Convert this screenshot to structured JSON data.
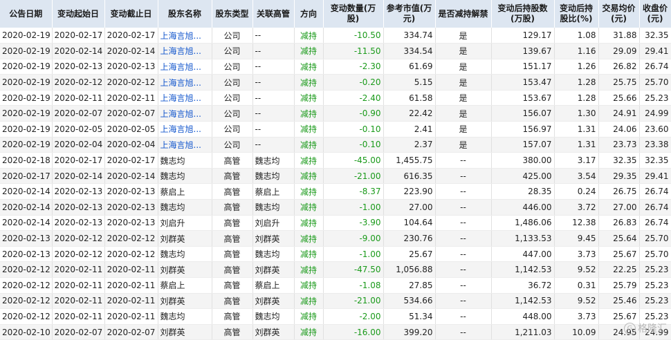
{
  "table": {
    "headers": [
      "公告日期",
      "变动起始日",
      "变动截止日",
      "股东名称",
      "股东类型",
      "关联高管",
      "方向",
      "变动数量(万股)",
      "参考市值(万元)",
      "是否减持解禁",
      "变动后持股数(万股)",
      "变动后持股比(%)",
      "交易均价(元)",
      "收盘价(元)"
    ],
    "rows": [
      [
        "2020-02-19",
        "2020-02-17",
        "2020-02-17",
        "上海言旭...",
        "公司",
        "--",
        "减持",
        "-10.50",
        "334.74",
        "是",
        "129.17",
        "1.08",
        "31.88",
        "32.35"
      ],
      [
        "2020-02-19",
        "2020-02-14",
        "2020-02-14",
        "上海言旭...",
        "公司",
        "--",
        "减持",
        "-11.50",
        "334.54",
        "是",
        "139.67",
        "1.16",
        "29.09",
        "29.41"
      ],
      [
        "2020-02-19",
        "2020-02-13",
        "2020-02-13",
        "上海言旭...",
        "公司",
        "--",
        "减持",
        "-2.30",
        "61.69",
        "是",
        "151.17",
        "1.26",
        "26.82",
        "26.74"
      ],
      [
        "2020-02-19",
        "2020-02-12",
        "2020-02-12",
        "上海言旭...",
        "公司",
        "--",
        "减持",
        "-0.20",
        "5.15",
        "是",
        "153.47",
        "1.28",
        "25.75",
        "25.70"
      ],
      [
        "2020-02-19",
        "2020-02-11",
        "2020-02-11",
        "上海言旭...",
        "公司",
        "--",
        "减持",
        "-2.40",
        "61.58",
        "是",
        "153.67",
        "1.28",
        "25.66",
        "25.23"
      ],
      [
        "2020-02-19",
        "2020-02-07",
        "2020-02-07",
        "上海言旭...",
        "公司",
        "--",
        "减持",
        "-0.90",
        "22.42",
        "是",
        "156.07",
        "1.30",
        "24.91",
        "24.99"
      ],
      [
        "2020-02-19",
        "2020-02-05",
        "2020-02-05",
        "上海言旭...",
        "公司",
        "--",
        "减持",
        "-0.10",
        "2.41",
        "是",
        "156.97",
        "1.31",
        "24.06",
        "23.60"
      ],
      [
        "2020-02-19",
        "2020-02-04",
        "2020-02-04",
        "上海言旭...",
        "公司",
        "--",
        "减持",
        "-0.10",
        "2.37",
        "是",
        "157.07",
        "1.31",
        "23.73",
        "23.38"
      ],
      [
        "2020-02-18",
        "2020-02-17",
        "2020-02-17",
        "魏志均",
        "高管",
        "魏志均",
        "减持",
        "-45.00",
        "1,455.75",
        "--",
        "380.00",
        "3.17",
        "32.35",
        "32.35"
      ],
      [
        "2020-02-17",
        "2020-02-14",
        "2020-02-14",
        "魏志均",
        "高管",
        "魏志均",
        "减持",
        "-21.00",
        "616.35",
        "--",
        "425.00",
        "3.54",
        "29.35",
        "29.41"
      ],
      [
        "2020-02-14",
        "2020-02-13",
        "2020-02-13",
        "蔡启上",
        "高管",
        "蔡启上",
        "减持",
        "-8.37",
        "223.90",
        "--",
        "28.35",
        "0.24",
        "26.75",
        "26.74"
      ],
      [
        "2020-02-14",
        "2020-02-13",
        "2020-02-13",
        "魏志均",
        "高管",
        "魏志均",
        "减持",
        "-1.00",
        "27.00",
        "--",
        "446.00",
        "3.72",
        "27.00",
        "26.74"
      ],
      [
        "2020-02-14",
        "2020-02-13",
        "2020-02-13",
        "刘启升",
        "高管",
        "刘启升",
        "减持",
        "-3.90",
        "104.64",
        "--",
        "1,486.06",
        "12.38",
        "26.83",
        "26.74"
      ],
      [
        "2020-02-13",
        "2020-02-12",
        "2020-02-12",
        "刘群英",
        "高管",
        "刘群英",
        "减持",
        "-9.00",
        "230.76",
        "--",
        "1,133.53",
        "9.45",
        "25.64",
        "25.70"
      ],
      [
        "2020-02-13",
        "2020-02-12",
        "2020-02-12",
        "魏志均",
        "高管",
        "魏志均",
        "减持",
        "-1.00",
        "25.67",
        "--",
        "447.00",
        "3.73",
        "25.67",
        "25.70"
      ],
      [
        "2020-02-12",
        "2020-02-11",
        "2020-02-11",
        "刘群英",
        "高管",
        "刘群英",
        "减持",
        "-47.50",
        "1,056.88",
        "--",
        "1,142.53",
        "9.52",
        "22.25",
        "25.23"
      ],
      [
        "2020-02-12",
        "2020-02-11",
        "2020-02-11",
        "蔡启上",
        "高管",
        "蔡启上",
        "减持",
        "-1.08",
        "27.85",
        "--",
        "36.72",
        "0.31",
        "25.79",
        "25.23"
      ],
      [
        "2020-02-12",
        "2020-02-11",
        "2020-02-11",
        "刘群英",
        "高管",
        "刘群英",
        "减持",
        "-21.00",
        "534.66",
        "--",
        "1,142.53",
        "9.52",
        "25.46",
        "25.23"
      ],
      [
        "2020-02-12",
        "2020-02-11",
        "2020-02-11",
        "魏志均",
        "高管",
        "魏志均",
        "减持",
        "-2.00",
        "51.34",
        "--",
        "448.00",
        "3.73",
        "25.67",
        "25.23"
      ],
      [
        "2020-02-10",
        "2020-02-07",
        "2020-02-07",
        "刘群英",
        "高管",
        "刘群英",
        "减持",
        "-16.00",
        "399.20",
        "--",
        "1,211.03",
        "10.09",
        "24.95",
        "24.99"
      ]
    ]
  },
  "watermark": {
    "text": "格隆汇"
  },
  "colors": {
    "header_bg": "#dde6f1",
    "link": "#1155cc",
    "reduce": "#1a9a1a"
  }
}
